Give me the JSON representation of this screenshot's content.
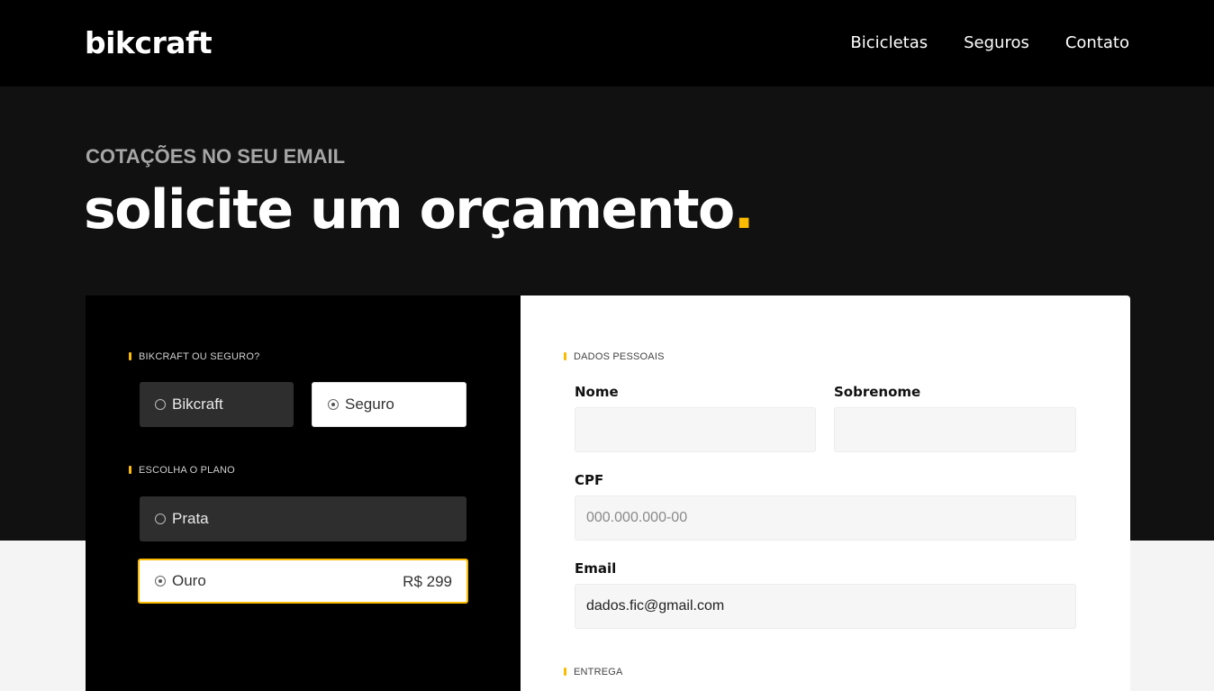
{
  "header": {
    "logo": "bikcraft",
    "nav": [
      "Bicicletas",
      "Seguros",
      "Contato"
    ]
  },
  "hero": {
    "eyebrow": "COTAÇÕES NO SEU EMAIL",
    "title": "solicite um orçamento",
    "title_dot": "."
  },
  "left_panel": {
    "type_label": "BIKCRAFT OU SEGURO?",
    "type_options": [
      "Bikcraft",
      "Seguro"
    ],
    "type_selected": "Seguro",
    "plan_label": "ESCOLHA O PLANO",
    "plan_options": [
      "Prata",
      "Ouro"
    ],
    "plan_selected": "Ouro",
    "plan_price": "R$ 299"
  },
  "right_panel": {
    "personal_label": "DADOS PESSOAIS",
    "fields": {
      "nome": {
        "label": "Nome",
        "value": ""
      },
      "sobrenome": {
        "label": "Sobrenome",
        "value": ""
      },
      "cpf": {
        "label": "CPF",
        "placeholder": "000.000.000-00",
        "value": ""
      },
      "email": {
        "label": "Email",
        "value": "dados.fic@gmail.com"
      }
    },
    "delivery_label": "ENTREGA"
  },
  "colors": {
    "accent": "#fbbb00",
    "header_bg": "#000000",
    "hero_bg": "#111111",
    "page_bg": "#f4f4f4"
  }
}
